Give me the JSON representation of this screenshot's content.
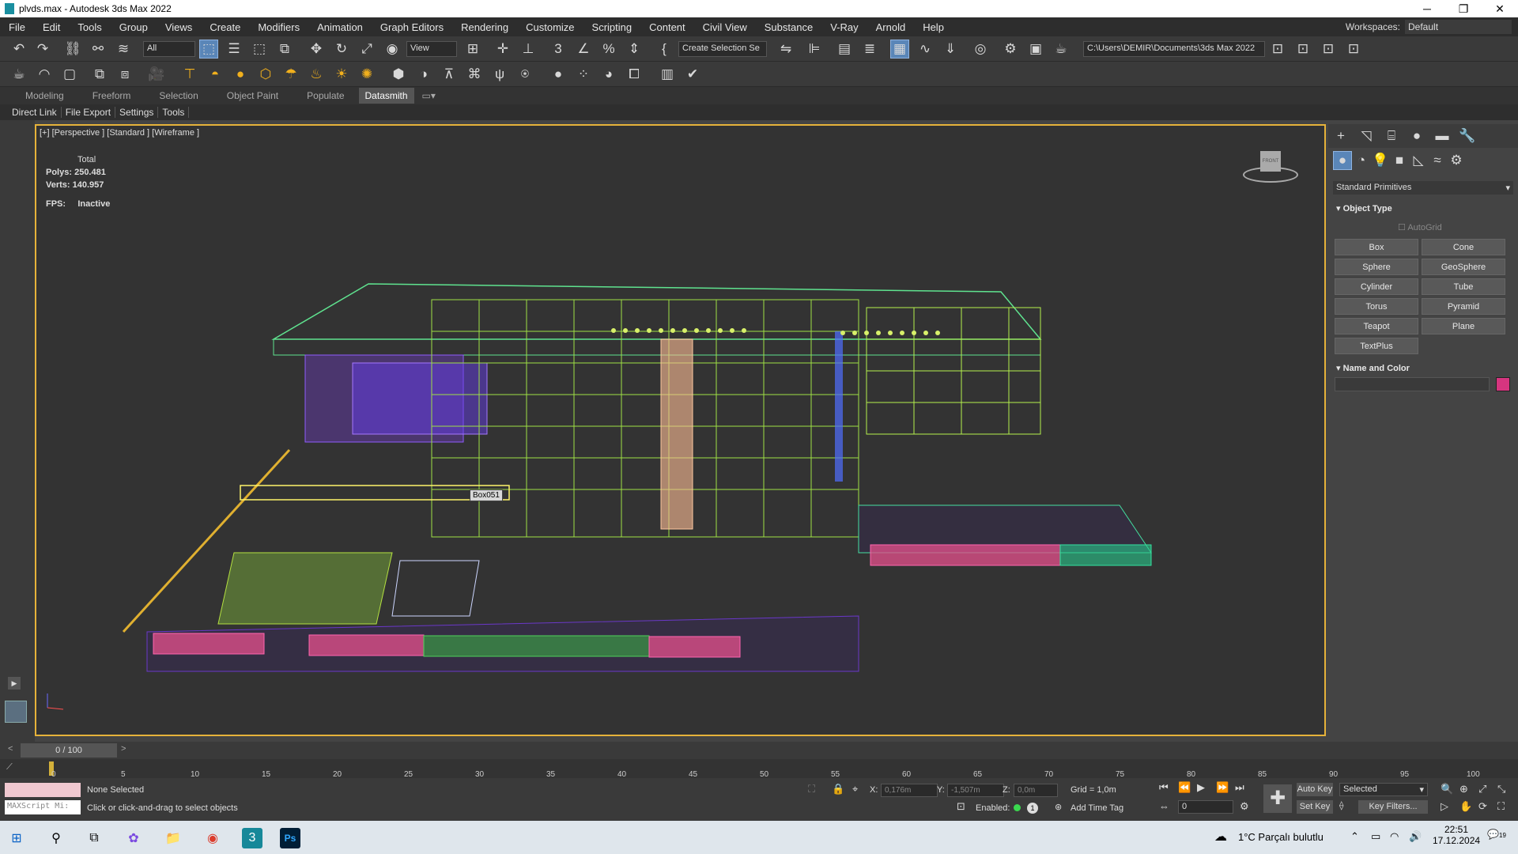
{
  "window": {
    "title": "plvds.max - Autodesk 3ds Max 2022",
    "min": "─",
    "max": "❐",
    "close": "✕"
  },
  "menu": [
    "File",
    "Edit",
    "Tools",
    "Group",
    "Views",
    "Create",
    "Modifiers",
    "Animation",
    "Graph Editors",
    "Rendering",
    "Customize",
    "Scripting",
    "Content",
    "Civil View",
    "Substance",
    "V-Ray",
    "Arnold",
    "Help"
  ],
  "workspaces": {
    "label": "Workspaces:",
    "value": "Default"
  },
  "toolbar": {
    "filter": "All",
    "refcoord": "View",
    "selection_set": "Create Selection Se",
    "project_path": "C:\\Users\\DEMIR\\Documents\\3ds Max 2022"
  },
  "ribbon": {
    "tabs": [
      "Modeling",
      "Freeform",
      "Selection",
      "Object Paint",
      "Populate",
      "Datasmith"
    ],
    "active": "Datasmith"
  },
  "subribbon": [
    "Direct Link",
    "File Export",
    "Settings",
    "Tools"
  ],
  "viewport": {
    "label": "[+] [Perspective ] [Standard ] [Wireframe ]",
    "stats_total": "Total",
    "polys_label": "Polys:",
    "polys": "250.481",
    "verts_label": "Verts:",
    "verts": "140.957",
    "fps_label": "FPS:",
    "fps": "Inactive",
    "tooltip": "Box051",
    "viewcube": "FRONT"
  },
  "command_panel": {
    "category": "Standard Primitives",
    "object_type_title": "Object Type",
    "autogrid": "AutoGrid",
    "buttons": [
      "Box",
      "Cone",
      "Sphere",
      "GeoSphere",
      "Cylinder",
      "Tube",
      "Torus",
      "Pyramid",
      "Teapot",
      "Plane",
      "TextPlus"
    ],
    "name_color_title": "Name and Color",
    "color": "#d6357f"
  },
  "timeslider": {
    "value": "0 / 100",
    "prev": "<",
    "next": ">"
  },
  "track_ticks": [
    "0",
    "5",
    "10",
    "15",
    "20",
    "25",
    "30",
    "35",
    "40",
    "45",
    "50",
    "55",
    "60",
    "65",
    "70",
    "75",
    "80",
    "85",
    "90",
    "95",
    "100"
  ],
  "status": {
    "maxscript": "MAXScript Mi:",
    "selection": "None Selected",
    "prompt": "Click or click-and-drag to select objects",
    "x_label": "X:",
    "x": "0,176m",
    "y_label": "Y:",
    "y": "-1,507m",
    "z_label": "Z:",
    "z": "0,0m",
    "grid": "Grid = 1,0m",
    "enabled": "Enabled:",
    "add_time_tag": "Add Time Tag",
    "auto_key": "Auto Key",
    "set_key": "Set Key",
    "key_mode": "Selected",
    "key_filters": "Key Filters...",
    "frame": "0"
  },
  "taskbar": {
    "weather": "1°C  Parçalı bulutlu",
    "time": "22:51",
    "date": "17.12.2024",
    "notif": "19"
  }
}
